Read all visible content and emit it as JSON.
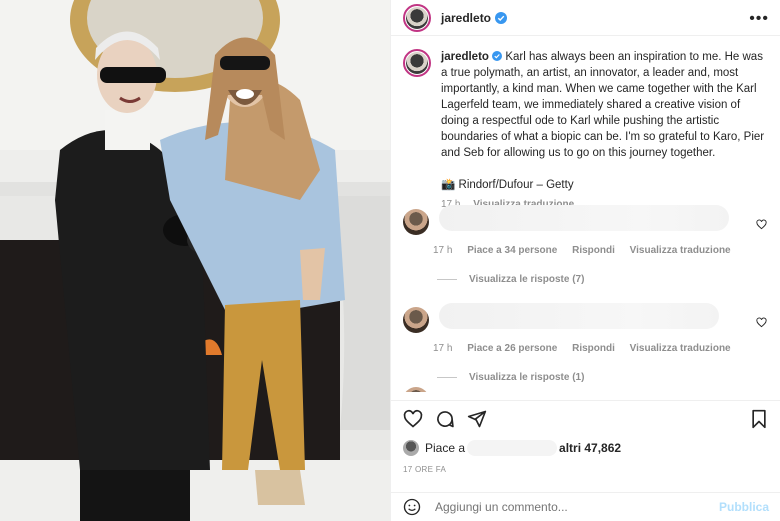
{
  "header": {
    "username": "jaredleto",
    "more_label": "•••"
  },
  "caption": {
    "username": "jaredleto",
    "text": "Karl has always been an inspiration to me. He was a true polymath, an artist, an innovator, a leader and, most importantly, a kind man. When we came together with the Karl Lagerfeld team, we immediately shared a creative vision of doing a respectful ode to Karl while pushing the artistic boundaries of what a biopic can be. I'm so grateful to Karo, Pier and Seb for allowing us to go on this journey together.",
    "credit": "📸 Rindorf/Dufour – Getty",
    "time": "17 h",
    "translate": "Visualizza traduzione"
  },
  "comments": [
    {
      "time": "17 h",
      "likes": "Piace a 34 persone",
      "reply": "Rispondi",
      "translate": "Visualizza traduzione",
      "replies": "Visualizza le risposte (7)"
    },
    {
      "time": "17 h",
      "likes": "Piace a 26 persone",
      "reply": "Rispondi",
      "translate": "Visualizza traduzione",
      "replies": "Visualizza le risposte (1)"
    }
  ],
  "likes": {
    "prefix": "Piace a",
    "suffix": "altri 47,862"
  },
  "time_ago": "17 ORE FA",
  "add_comment": {
    "placeholder": "Aggiungi un commento...",
    "publish": "Pubblica"
  },
  "colors": {
    "verified": "#3897f0",
    "publish": "#b2dffc",
    "meta": "#8e8e8e"
  }
}
